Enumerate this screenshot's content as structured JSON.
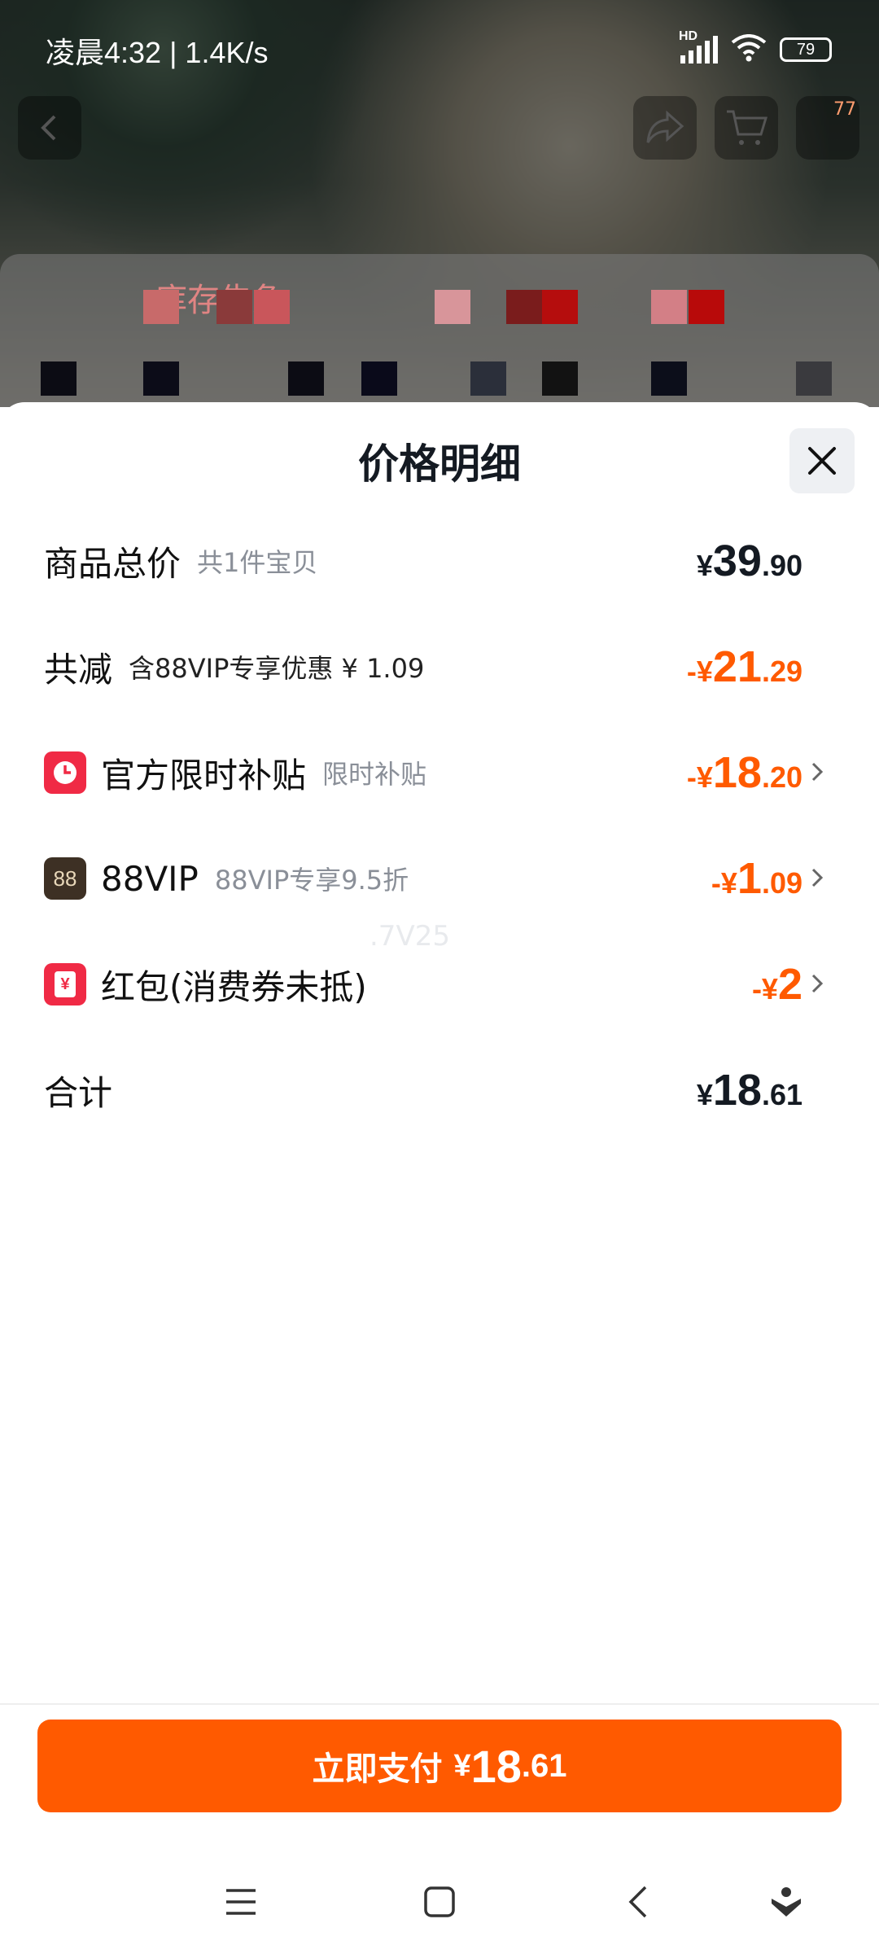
{
  "status_bar": {
    "time": "凌晨4:32 | 1.4K/s",
    "battery": "79",
    "network_label": "HD"
  },
  "background": {
    "cart_badge": "77",
    "stock_label": "库存告急"
  },
  "sheet": {
    "title": "价格明细",
    "watermark": ".7V25",
    "rows": [
      {
        "label": "商品总价",
        "sub": "共1件宝贝",
        "yen": "¥",
        "int": "39",
        "dec": ".90"
      },
      {
        "label": "共减",
        "sub": "含88VIP专享优惠 ¥ 1.09",
        "yen": "-¥",
        "int": "21",
        "dec": ".29"
      },
      {
        "label": "官方限时补贴",
        "sub": "限时补贴",
        "yen": "-¥",
        "int": "18",
        "dec": ".20",
        "icon": "clock-icon"
      },
      {
        "label": "88VIP",
        "sub": "88VIP专享9.5折",
        "yen": "-¥",
        "int": "1",
        "dec": ".09",
        "icon_text": "88"
      },
      {
        "label": "红包(消费券未抵)",
        "sub": "",
        "yen": "-¥",
        "int": "2",
        "dec": "",
        "icon_text": "¥"
      },
      {
        "label": "合计",
        "sub": "",
        "yen": "¥",
        "int": "18",
        "dec": ".61"
      }
    ]
  },
  "pay_button": {
    "label": "立即支付",
    "yen": "¥",
    "int": "18",
    "dec": ".61"
  },
  "colors": {
    "accent": "#ff5a00",
    "subsidy_icon": "#f02a45",
    "vip_icon": "#3d3024"
  }
}
